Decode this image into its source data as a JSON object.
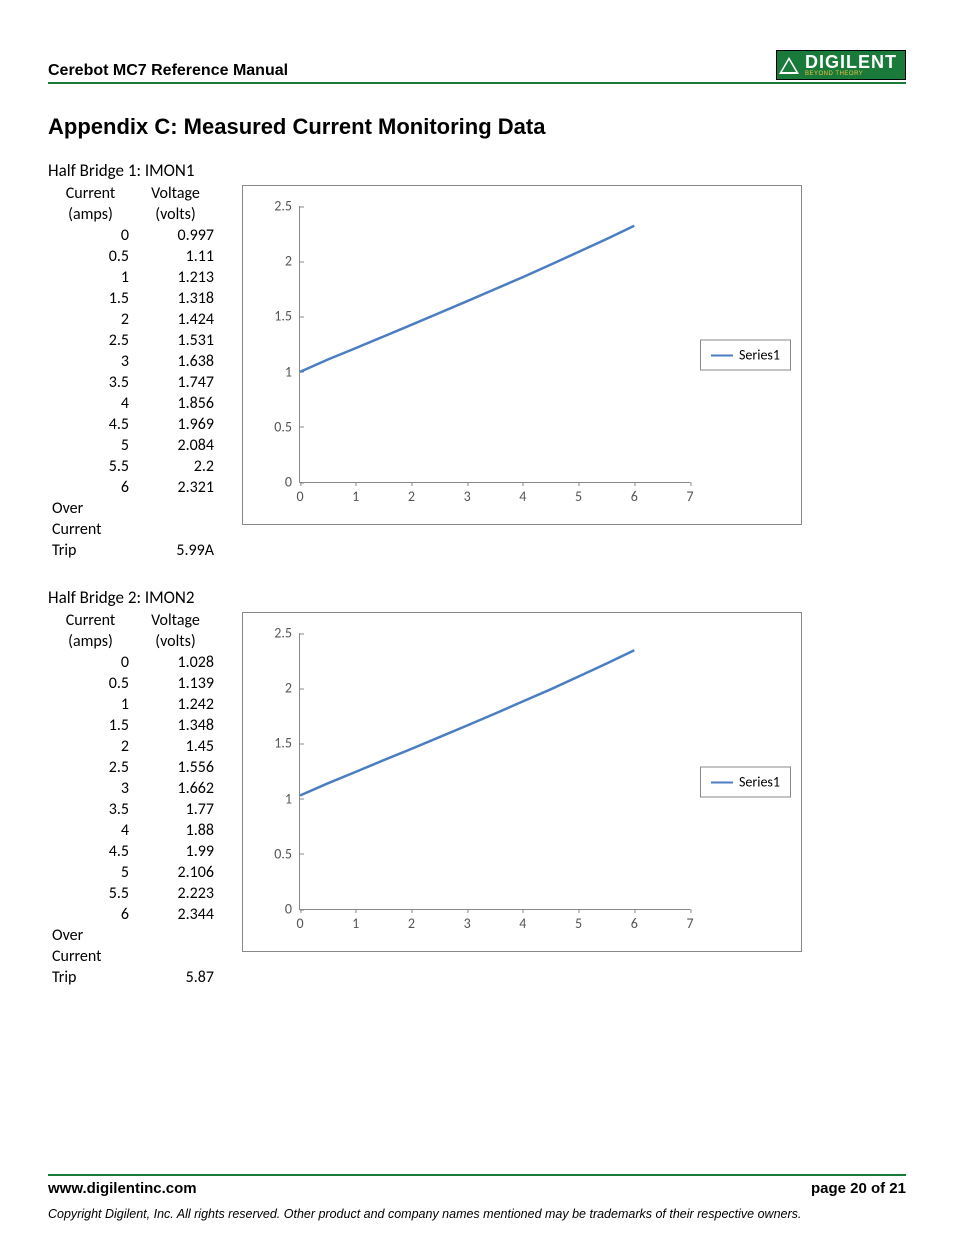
{
  "header": {
    "title": "Cerebot MC7 Reference Manual",
    "logo_text": "DIGILENT",
    "logo_sub": "BEYOND THEORY"
  },
  "appendix_title": "Appendix C: Measured Current Monitoring Data",
  "sections": [
    {
      "title": "Half Bridge 1: IMON1",
      "col1_label_a": "Current",
      "col1_label_b": "(amps)",
      "col2_label_a": "Voltage",
      "col2_label_b": "(volts)",
      "rows": [
        {
          "c": "0",
          "v": "0.997"
        },
        {
          "c": "0.5",
          "v": "1.11"
        },
        {
          "c": "1",
          "v": "1.213"
        },
        {
          "c": "1.5",
          "v": "1.318"
        },
        {
          "c": "2",
          "v": "1.424"
        },
        {
          "c": "2.5",
          "v": "1.531"
        },
        {
          "c": "3",
          "v": "1.638"
        },
        {
          "c": "3.5",
          "v": "1.747"
        },
        {
          "c": "4",
          "v": "1.856"
        },
        {
          "c": "4.5",
          "v": "1.969"
        },
        {
          "c": "5",
          "v": "2.084"
        },
        {
          "c": "5.5",
          "v": "2.2"
        },
        {
          "c": "6",
          "v": "2.321"
        }
      ],
      "oct_label_1": "Over",
      "oct_label_2": "Current",
      "oct_label_3": "Trip",
      "oct_value": "5.99A",
      "legend": "Series1"
    },
    {
      "title": "Half Bridge 2: IMON2",
      "col1_label_a": "Current",
      "col1_label_b": "(amps)",
      "col2_label_a": "Voltage",
      "col2_label_b": "(volts)",
      "rows": [
        {
          "c": "0",
          "v": "1.028"
        },
        {
          "c": "0.5",
          "v": "1.139"
        },
        {
          "c": "1",
          "v": "1.242"
        },
        {
          "c": "1.5",
          "v": "1.348"
        },
        {
          "c": "2",
          "v": "1.45"
        },
        {
          "c": "2.5",
          "v": "1.556"
        },
        {
          "c": "3",
          "v": "1.662"
        },
        {
          "c": "3.5",
          "v": "1.77"
        },
        {
          "c": "4",
          "v": "1.88"
        },
        {
          "c": "4.5",
          "v": "1.99"
        },
        {
          "c": "5",
          "v": "2.106"
        },
        {
          "c": "5.5",
          "v": "2.223"
        },
        {
          "c": "6",
          "v": "2.344"
        }
      ],
      "oct_label_1": "Over",
      "oct_label_2": "Current",
      "oct_label_3": "Trip",
      "oct_value": "5.87",
      "legend": "Series1"
    }
  ],
  "chart_axes": {
    "x_ticks": [
      "0",
      "1",
      "2",
      "3",
      "4",
      "5",
      "6",
      "7"
    ],
    "y_ticks": [
      "0",
      "0.5",
      "1",
      "1.5",
      "2",
      "2.5"
    ],
    "x_min": 0,
    "x_max": 7,
    "y_min": 0,
    "y_max": 2.5
  },
  "chart_data": [
    {
      "type": "line",
      "title": "Half Bridge 1: IMON1",
      "xlabel": "",
      "ylabel": "",
      "xlim": [
        0,
        7
      ],
      "ylim": [
        0,
        2.5
      ],
      "legend_position": "right",
      "series": [
        {
          "name": "Series1",
          "x": [
            0,
            0.5,
            1,
            1.5,
            2,
            2.5,
            3,
            3.5,
            4,
            4.5,
            5,
            5.5,
            6
          ],
          "y": [
            0.997,
            1.11,
            1.213,
            1.318,
            1.424,
            1.531,
            1.638,
            1.747,
            1.856,
            1.969,
            2.084,
            2.2,
            2.321
          ]
        }
      ]
    },
    {
      "type": "line",
      "title": "Half Bridge 2: IMON2",
      "xlabel": "",
      "ylabel": "",
      "xlim": [
        0,
        7
      ],
      "ylim": [
        0,
        2.5
      ],
      "legend_position": "right",
      "series": [
        {
          "name": "Series1",
          "x": [
            0,
            0.5,
            1,
            1.5,
            2,
            2.5,
            3,
            3.5,
            4,
            4.5,
            5,
            5.5,
            6
          ],
          "y": [
            1.028,
            1.139,
            1.242,
            1.348,
            1.45,
            1.556,
            1.662,
            1.77,
            1.88,
            1.99,
            2.106,
            2.223,
            2.344
          ]
        }
      ]
    }
  ],
  "footer": {
    "url": "www.digilentinc.com",
    "page": "page 20 of 21",
    "copyright": "Copyright Digilent, Inc. All rights reserved. Other product and company names mentioned may be trademarks of their respective owners."
  }
}
